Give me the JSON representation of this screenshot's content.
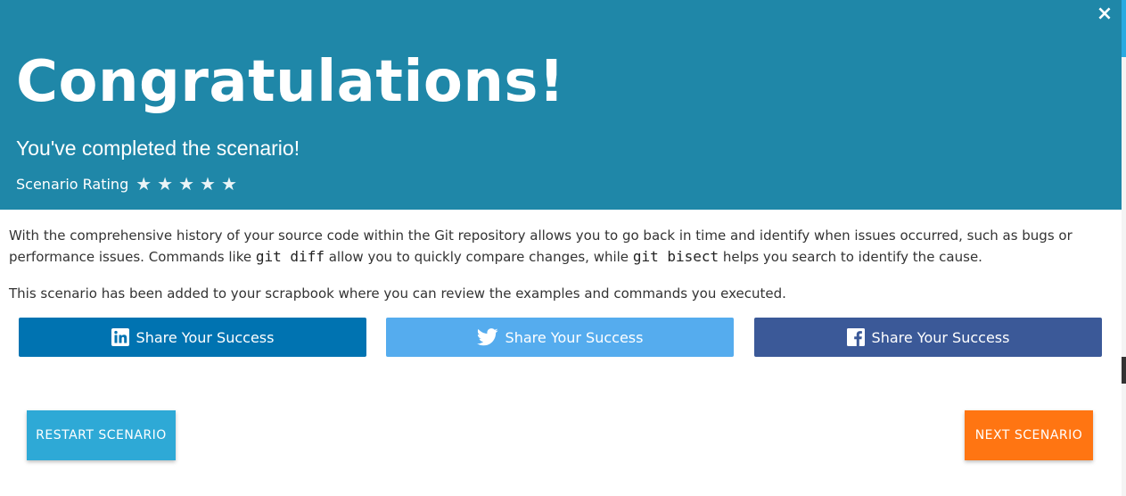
{
  "modal": {
    "close_label": "×",
    "title": "Congratulations!",
    "subtitle": "You've completed the scenario!",
    "rating": {
      "label": "Scenario Rating",
      "stars": 5,
      "filled": 0,
      "star_glyph": "★"
    }
  },
  "body": {
    "para1_text_a": "With the comprehensive history of your source code within the Git repository allows you to go back in time and identify when issues occurred, such as bugs or performance issues. Commands like ",
    "para1_code_a": "git diff",
    "para1_text_b": " allow you to quickly compare changes, while ",
    "para1_code_b": "git bisect",
    "para1_text_c": " helps you search to identify the cause.",
    "para2": "This scenario has been added to your scrapbook where you can review the examples and commands you executed."
  },
  "share": {
    "linkedin": {
      "label": "Share Your Success",
      "icon": "linkedin-icon",
      "color": "#0073b1"
    },
    "twitter": {
      "label": "Share Your Success",
      "icon": "twitter-icon",
      "color": "#55acee"
    },
    "facebook": {
      "label": "Share Your Success",
      "icon": "facebook-icon",
      "color": "#3b5998"
    }
  },
  "actions": {
    "restart_label": "RESTART SCENARIO",
    "next_label": "NEXT SCENARIO"
  },
  "colors": {
    "header_bg": "#1f87a8",
    "restart_bg": "#2ea9d6",
    "next_bg": "#ff7512"
  }
}
